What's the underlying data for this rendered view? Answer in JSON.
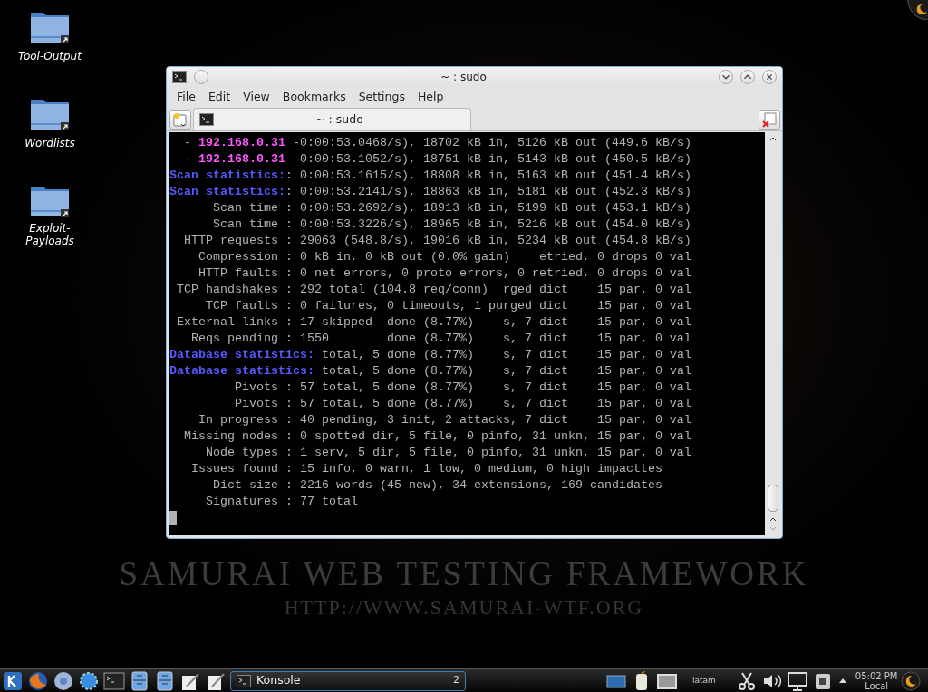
{
  "desktop_icons": [
    {
      "label": "Tool-Output"
    },
    {
      "label": "Wordlists"
    },
    {
      "label": "Exploit-\nPayloads"
    }
  ],
  "wallpaper": {
    "title": "SAMURAI WEB TESTING FRAMEWORK",
    "url": "HTTP://WWW.SAMURAI-WTF.ORG"
  },
  "window": {
    "title": "~ : sudo",
    "menu": [
      "File",
      "Edit",
      "View",
      "Bookmarks",
      "Settings",
      "Help"
    ],
    "tabs": [
      {
        "label": "~ : sudo",
        "selected": true
      }
    ],
    "terminal": {
      "lines": [
        {
          "segments": [
            {
              "kind": "plain",
              "text": "  - "
            },
            {
              "kind": "address",
              "text": "192.168.0.31"
            },
            {
              "kind": "plain",
              "text": " -0:00:53.0468/s), 18702 kB in, 5126 kB out (449.6 kB/s)"
            }
          ]
        },
        {
          "segments": [
            {
              "kind": "plain",
              "text": "  - "
            },
            {
              "kind": "address",
              "text": "192.168.0.31"
            },
            {
              "kind": "plain",
              "text": " -0:00:53.1052/s), 18751 kB in, 5143 kB out (450.5 kB/s)"
            }
          ]
        },
        {
          "segments": [
            {
              "kind": "heading",
              "text": "Scan statistics:"
            },
            {
              "kind": "plain",
              "text": ": 0:00:53.1615/s), 18808 kB in, 5163 kB out (451.4 kB/s)"
            }
          ]
        },
        {
          "segments": [
            {
              "kind": "heading",
              "text": "Scan statistics:"
            },
            {
              "kind": "plain",
              "text": ": 0:00:53.2141/s), 18863 kB in, 5181 kB out (452.3 kB/s)"
            }
          ]
        },
        {
          "segments": [
            {
              "kind": "plain",
              "text": "      Scan time : 0:00:53.2692/s), 18913 kB in, 5199 kB out (453.1 kB/s)"
            }
          ]
        },
        {
          "segments": [
            {
              "kind": "plain",
              "text": "      Scan time : 0:00:53.3226/s), 18965 kB in, 5216 kB out (454.0 kB/s)"
            }
          ]
        },
        {
          "segments": [
            {
              "kind": "plain",
              "text": "  HTTP requests : 29063 (548.8/s), 19016 kB in, 5234 kB out (454.8 kB/s)"
            }
          ]
        },
        {
          "segments": [
            {
              "kind": "plain",
              "text": "    Compression : 0 kB in, 0 kB out (0.0% gain)    etried, 0 drops 0 val"
            }
          ]
        },
        {
          "segments": [
            {
              "kind": "plain",
              "text": "    HTTP faults : 0 net errors, 0 proto errors, 0 retried, 0 drops 0 val"
            }
          ]
        },
        {
          "segments": [
            {
              "kind": "plain",
              "text": " TCP handshakes : 292 total (104.8 req/conn)  rged dict    15 par, 0 val"
            }
          ]
        },
        {
          "segments": [
            {
              "kind": "plain",
              "text": "     TCP faults : 0 failures, 0 timeouts, 1 purged dict    15 par, 0 val"
            }
          ]
        },
        {
          "segments": [
            {
              "kind": "plain",
              "text": " External links : 17 skipped  done (8.77%)    s, 7 dict    15 par, 0 val"
            }
          ]
        },
        {
          "segments": [
            {
              "kind": "plain",
              "text": "   Reqs pending : 1550        done (8.77%)    s, 7 dict    15 par, 0 val"
            }
          ]
        },
        {
          "segments": [
            {
              "kind": "heading",
              "text": "Database statistics:"
            },
            {
              "kind": "plain",
              "text": " total, 5 done (8.77%)    s, 7 dict    15 par, 0 val"
            }
          ]
        },
        {
          "segments": [
            {
              "kind": "heading",
              "text": "Database statistics:"
            },
            {
              "kind": "plain",
              "text": " total, 5 done (8.77%)    s, 7 dict    15 par, 0 val"
            }
          ]
        },
        {
          "segments": [
            {
              "kind": "plain",
              "text": "         Pivots : 57 total, 5 done (8.77%)    s, 7 dict    15 par, 0 val"
            }
          ]
        },
        {
          "segments": [
            {
              "kind": "plain",
              "text": "         Pivots : 57 total, 5 done (8.77%)    s, 7 dict    15 par, 0 val"
            }
          ]
        },
        {
          "segments": [
            {
              "kind": "plain",
              "text": "    In progress : 40 pending, 3 init, 2 attacks, 7 dict    15 par, 0 val"
            }
          ]
        },
        {
          "segments": [
            {
              "kind": "plain",
              "text": "  Missing nodes : 0 spotted dir, 5 file, 0 pinfo, 31 unkn, 15 par, 0 val"
            }
          ]
        },
        {
          "segments": [
            {
              "kind": "plain",
              "text": "     Node types : 1 serv, 5 dir, 5 file, 0 pinfo, 31 unkn, 15 par, 0 val"
            }
          ]
        },
        {
          "segments": [
            {
              "kind": "plain",
              "text": "   Issues found : 15 info, 0 warn, 1 low, 0 medium, 0 high impacttes"
            }
          ]
        },
        {
          "segments": [
            {
              "kind": "plain",
              "text": "      Dict size : 2216 words (45 new), 34 extensions, 169 candidates"
            }
          ]
        },
        {
          "segments": [
            {
              "kind": "plain",
              "text": "     Signatures : 77 total"
            }
          ]
        }
      ]
    }
  },
  "taskbar": {
    "task": {
      "label": "Konsole",
      "count": "2"
    },
    "keyboard_layout": "latam",
    "time": "05:02 PM",
    "timezone": "Local"
  }
}
